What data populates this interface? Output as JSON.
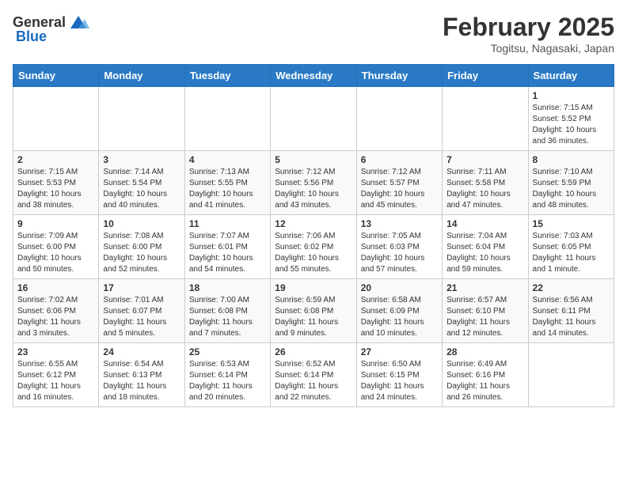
{
  "header": {
    "logo_general": "General",
    "logo_blue": "Blue",
    "month_year": "February 2025",
    "location": "Togitsu, Nagasaki, Japan"
  },
  "days_of_week": [
    "Sunday",
    "Monday",
    "Tuesday",
    "Wednesday",
    "Thursday",
    "Friday",
    "Saturday"
  ],
  "weeks": [
    [
      {
        "day": "",
        "info": ""
      },
      {
        "day": "",
        "info": ""
      },
      {
        "day": "",
        "info": ""
      },
      {
        "day": "",
        "info": ""
      },
      {
        "day": "",
        "info": ""
      },
      {
        "day": "",
        "info": ""
      },
      {
        "day": "1",
        "info": "Sunrise: 7:15 AM\nSunset: 5:52 PM\nDaylight: 10 hours and 36 minutes."
      }
    ],
    [
      {
        "day": "2",
        "info": "Sunrise: 7:15 AM\nSunset: 5:53 PM\nDaylight: 10 hours and 38 minutes."
      },
      {
        "day": "3",
        "info": "Sunrise: 7:14 AM\nSunset: 5:54 PM\nDaylight: 10 hours and 40 minutes."
      },
      {
        "day": "4",
        "info": "Sunrise: 7:13 AM\nSunset: 5:55 PM\nDaylight: 10 hours and 41 minutes."
      },
      {
        "day": "5",
        "info": "Sunrise: 7:12 AM\nSunset: 5:56 PM\nDaylight: 10 hours and 43 minutes."
      },
      {
        "day": "6",
        "info": "Sunrise: 7:12 AM\nSunset: 5:57 PM\nDaylight: 10 hours and 45 minutes."
      },
      {
        "day": "7",
        "info": "Sunrise: 7:11 AM\nSunset: 5:58 PM\nDaylight: 10 hours and 47 minutes."
      },
      {
        "day": "8",
        "info": "Sunrise: 7:10 AM\nSunset: 5:59 PM\nDaylight: 10 hours and 48 minutes."
      }
    ],
    [
      {
        "day": "9",
        "info": "Sunrise: 7:09 AM\nSunset: 6:00 PM\nDaylight: 10 hours and 50 minutes."
      },
      {
        "day": "10",
        "info": "Sunrise: 7:08 AM\nSunset: 6:00 PM\nDaylight: 10 hours and 52 minutes."
      },
      {
        "day": "11",
        "info": "Sunrise: 7:07 AM\nSunset: 6:01 PM\nDaylight: 10 hours and 54 minutes."
      },
      {
        "day": "12",
        "info": "Sunrise: 7:06 AM\nSunset: 6:02 PM\nDaylight: 10 hours and 55 minutes."
      },
      {
        "day": "13",
        "info": "Sunrise: 7:05 AM\nSunset: 6:03 PM\nDaylight: 10 hours and 57 minutes."
      },
      {
        "day": "14",
        "info": "Sunrise: 7:04 AM\nSunset: 6:04 PM\nDaylight: 10 hours and 59 minutes."
      },
      {
        "day": "15",
        "info": "Sunrise: 7:03 AM\nSunset: 6:05 PM\nDaylight: 11 hours and 1 minute."
      }
    ],
    [
      {
        "day": "16",
        "info": "Sunrise: 7:02 AM\nSunset: 6:06 PM\nDaylight: 11 hours and 3 minutes."
      },
      {
        "day": "17",
        "info": "Sunrise: 7:01 AM\nSunset: 6:07 PM\nDaylight: 11 hours and 5 minutes."
      },
      {
        "day": "18",
        "info": "Sunrise: 7:00 AM\nSunset: 6:08 PM\nDaylight: 11 hours and 7 minutes."
      },
      {
        "day": "19",
        "info": "Sunrise: 6:59 AM\nSunset: 6:08 PM\nDaylight: 11 hours and 9 minutes."
      },
      {
        "day": "20",
        "info": "Sunrise: 6:58 AM\nSunset: 6:09 PM\nDaylight: 11 hours and 10 minutes."
      },
      {
        "day": "21",
        "info": "Sunrise: 6:57 AM\nSunset: 6:10 PM\nDaylight: 11 hours and 12 minutes."
      },
      {
        "day": "22",
        "info": "Sunrise: 6:56 AM\nSunset: 6:11 PM\nDaylight: 11 hours and 14 minutes."
      }
    ],
    [
      {
        "day": "23",
        "info": "Sunrise: 6:55 AM\nSunset: 6:12 PM\nDaylight: 11 hours and 16 minutes."
      },
      {
        "day": "24",
        "info": "Sunrise: 6:54 AM\nSunset: 6:13 PM\nDaylight: 11 hours and 18 minutes."
      },
      {
        "day": "25",
        "info": "Sunrise: 6:53 AM\nSunset: 6:14 PM\nDaylight: 11 hours and 20 minutes."
      },
      {
        "day": "26",
        "info": "Sunrise: 6:52 AM\nSunset: 6:14 PM\nDaylight: 11 hours and 22 minutes."
      },
      {
        "day": "27",
        "info": "Sunrise: 6:50 AM\nSunset: 6:15 PM\nDaylight: 11 hours and 24 minutes."
      },
      {
        "day": "28",
        "info": "Sunrise: 6:49 AM\nSunset: 6:16 PM\nDaylight: 11 hours and 26 minutes."
      },
      {
        "day": "",
        "info": ""
      }
    ]
  ]
}
